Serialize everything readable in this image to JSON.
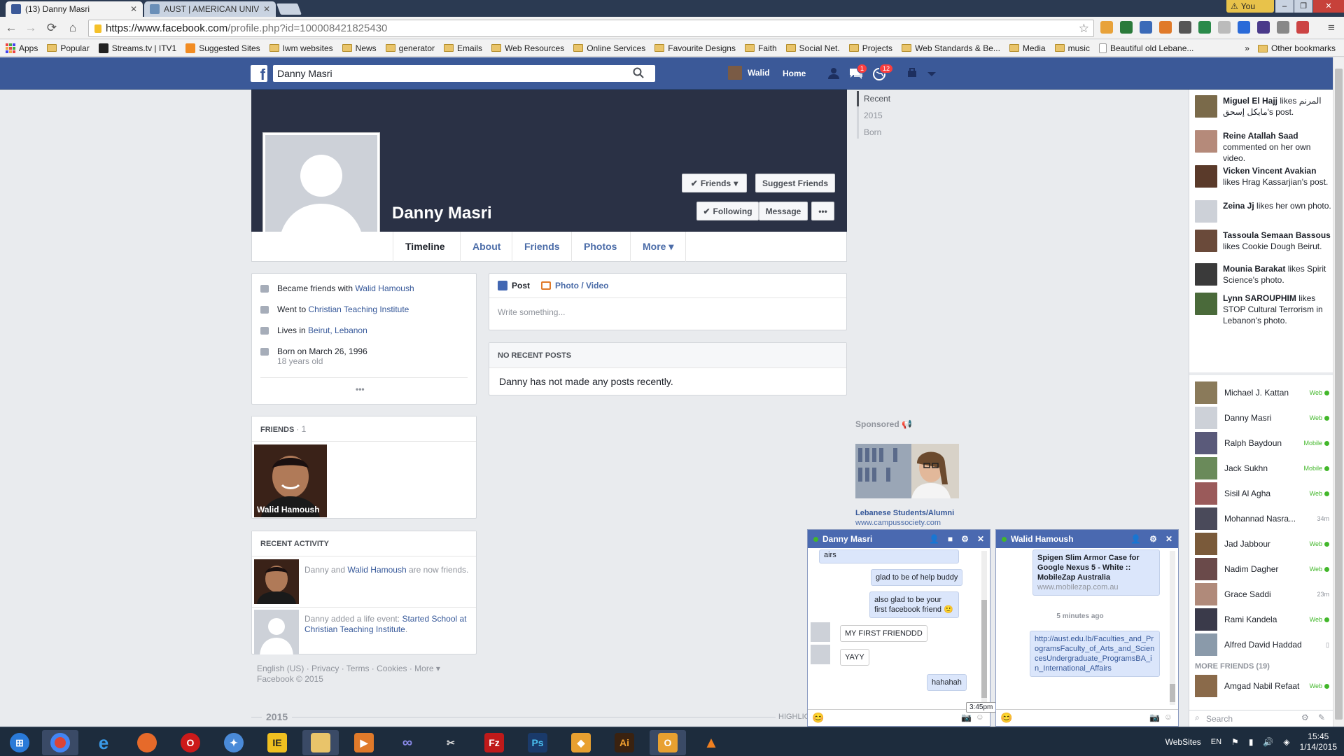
{
  "browser": {
    "tabs": [
      {
        "title": "(13) Danny Masri",
        "active": true
      },
      {
        "title": "AUST | AMERICAN UNIVE",
        "active": false
      }
    ],
    "user_badge": "You",
    "url_host": "https://www.facebook.com",
    "url_path": "/profile.php?id=100008421825430",
    "bookmarks": [
      "Apps",
      "Popular",
      "Streams.tv | ITV1",
      "Suggested Sites",
      "Iwm websites",
      "News",
      "generator",
      "Emails",
      "Web Resources",
      "Online Services",
      "Favourite Designs",
      "Faith",
      "Social Net.",
      "Projects",
      "Web Standards & Be...",
      "Media",
      "music",
      "Beautiful old Lebane..."
    ],
    "bookmarks_more": "»",
    "other_bookmarks": "Other bookmarks"
  },
  "fb": {
    "search_value": "Danny Masri",
    "user_name": "Walid",
    "home_label": "Home",
    "messages_badge": "1",
    "notifications_badge": "12"
  },
  "profile": {
    "name": "Danny Masri",
    "friends_btn": "Friends",
    "suggest_btn": "Suggest Friends",
    "following_btn": "Following",
    "message_btn": "Message",
    "more_btn": "•••",
    "tabs": [
      "Timeline",
      "About",
      "Friends",
      "Photos",
      "More"
    ]
  },
  "intro": {
    "row1_prefix": "Became friends with",
    "row1_link": "Walid Hamoush",
    "row2_prefix": "Went to",
    "row2_link": "Christian Teaching Institute",
    "row3_prefix": "Lives in",
    "row3_link": "Beirut, Lebanon",
    "row4_text": "Born on March 26, 1996",
    "row4_sub": "18 years old",
    "more": "•••"
  },
  "friends_box": {
    "header": "FRIENDS",
    "count": "· 1",
    "friend_name": "Walid Hamoush"
  },
  "recent_activity": {
    "header": "RECENT ACTIVITY",
    "item1_pre": "Danny and",
    "item1_link": "Walid Hamoush",
    "item1_post": "are now friends.",
    "item2_pre": "Danny added a life event:",
    "item2_link": "Started School at Christian Teaching Institute",
    "item2_post": "."
  },
  "footer": {
    "line1": "English (US) · Privacy · Terms · Cookies · More ▾",
    "line2": "Facebook © 2015",
    "year_marker": "2015",
    "highlights": "HIGHLIG"
  },
  "composer": {
    "post_tab": "Post",
    "photo_tab": "Photo / Video",
    "placeholder": "Write something..."
  },
  "posts": {
    "header": "NO RECENT POSTS",
    "message": "Danny has not made any posts recently."
  },
  "timeline_nav": [
    "Recent",
    "2015",
    "Born"
  ],
  "sponsored": {
    "label": "Sponsored",
    "title": "Lebanese Students/Alumni",
    "url": "www.campussociety.com"
  },
  "ticker": [
    {
      "name": "Miguel El Hajj",
      "text": "likes المرنم مايكل إسحق's post.",
      "color": "#7a6a4a"
    },
    {
      "name": "Reine Atallah Saad",
      "text": "commented on her own video.",
      "color": "#b58a7a"
    },
    {
      "name": "Vicken Vincent Avakian",
      "text": "likes Hrag Kassarjian's post.",
      "color": "#5a3a2a"
    },
    {
      "name": "Zeina Jj",
      "text": "likes her own photo.",
      "color": "#cdd1d8"
    },
    {
      "name": "Tassoula Semaan Bassous",
      "text": "likes Cookie Dough Beirut.",
      "color": "#6a4a3a"
    },
    {
      "name": "Mounia Barakat",
      "text": "likes Spirit Science's photo.",
      "color": "#3a3a3a"
    },
    {
      "name": "Lynn SAROUPHIM",
      "text": "likes STOP Cultural Terrorism in Lebanon's photo.",
      "color": "#4a6a3a"
    }
  ],
  "chat_list": [
    {
      "name": "Michael J. Kattan",
      "status": "Web",
      "color": "#8a7a5a"
    },
    {
      "name": "Danny Masri",
      "status": "Web",
      "color": "#cdd1d8"
    },
    {
      "name": "Ralph Baydoun",
      "status": "Mobile",
      "color": "#5a5a7a"
    },
    {
      "name": "Jack Sukhn",
      "status": "Mobile",
      "color": "#6a8a5a"
    },
    {
      "name": "Sisil Al Agha",
      "status": "Web",
      "color": "#9a5a5a"
    },
    {
      "name": "Mohannad Nasra...",
      "status": "34m",
      "color": "#4a4a5a"
    },
    {
      "name": "Jad Jabbour",
      "status": "Web",
      "color": "#7a5a3a"
    },
    {
      "name": "Nadim Dagher",
      "status": "Web",
      "color": "#6a4a4a"
    },
    {
      "name": "Grace Saddi",
      "status": "23m",
      "color": "#b08a7a"
    },
    {
      "name": "Rami Kandela",
      "status": "Web",
      "color": "#3a3a4a"
    },
    {
      "name": "Alfred David Haddad",
      "status": "",
      "color": "#8a9aaa"
    }
  ],
  "more_friends": "MORE FRIENDS (19)",
  "more_friends_first": {
    "name": "Amgad Nabil Refaat",
    "status": "Web"
  },
  "chat_search": "Search",
  "chat1": {
    "title": "Danny Masri",
    "messages": [
      "airs",
      "glad to be of help buddy",
      "also glad to be your first facebook friend 🙂",
      "MY FIRST FRIENDDD",
      "YAYY",
      "hahahah"
    ],
    "tooltip": "3:45pm"
  },
  "chat2": {
    "title": "Walid Hamoush",
    "link_title": "Spigen Slim Armor Case for Google Nexus 5 - White :: MobileZap Australia",
    "link_url": "www.mobilezap.com.au",
    "time_sep": "5 minutes ago",
    "link2": "http://aust.edu.lb/Faculties_and_ProgramsFaculty_of_Arts_and_SciencesUndergraduate_ProgramsBA_in_International_Affairs"
  },
  "taskbar": {
    "websites": "WebSites",
    "lang": "EN",
    "time": "15:45",
    "date": "1/14/2015"
  }
}
